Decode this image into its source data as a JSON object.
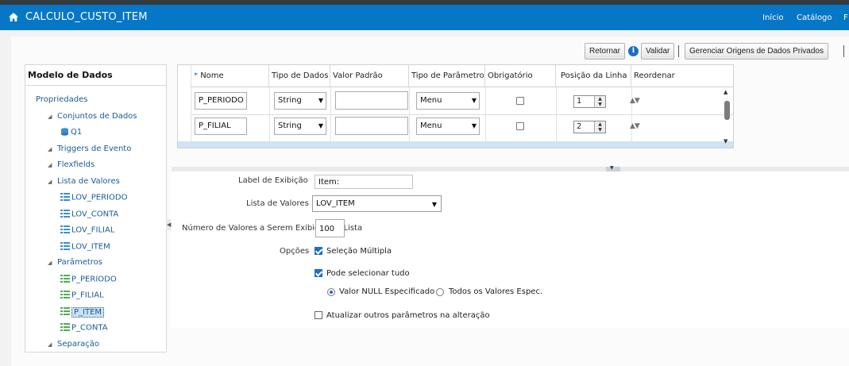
{
  "header": {
    "title": "CALCULO_CUSTO_ITEM",
    "links": [
      "Início",
      "Catálogo",
      "F"
    ]
  },
  "toolbar": {
    "return_label": "Retornar",
    "info_icon": "i",
    "validate_label": "Validar",
    "manage_label": "Gerenciar Origens de Dados Privados"
  },
  "left_panel": {
    "title": "Modelo de Dados",
    "tree": {
      "properties": "Propriedades",
      "datasets": "Conjuntos de Dados",
      "q1": "Q1",
      "triggers": "Triggers de Evento",
      "flexfields": "Flexfields",
      "lov_list": "Lista de Valores",
      "lov_periodo": "LOV_PERIODO",
      "lov_conta": "LOV_CONTA",
      "lov_filial": "LOV_FILIAL",
      "lov_item": "LOV_ITEM",
      "parameters": "Parâmetros",
      "p_periodo": "P_PERIODO",
      "p_filial": "P_FILIAL",
      "p_item": "P_ITEM",
      "p_conta": "P_CONTA",
      "separation": "Separação"
    }
  },
  "grid": {
    "required_marker": "*",
    "headers": [
      "Nome",
      "Tipo de Dados",
      "Valor Padrão",
      "Tipo de Parâmetro",
      "Obrigatório",
      "Posição da Linha",
      "Reordenar"
    ],
    "rows": [
      {
        "name": "P_PERIODO",
        "data_type": "String",
        "default": "",
        "param_type": "Menu",
        "required": false,
        "position": "1"
      },
      {
        "name": "P_FILIAL",
        "data_type": "String",
        "default": "",
        "param_type": "Menu",
        "required": false,
        "position": "2"
      }
    ]
  },
  "detail": {
    "display_label_label": "Label de Exibição",
    "display_label_value": "Item:",
    "lov_label": "Lista de Valores",
    "lov_value": "LOV_ITEM",
    "num_values_label": "Número de Valores a Serem Exibidos na Lista",
    "num_values_value": "100",
    "options_label": "Opções",
    "multi_select": "Seleção Múltipla",
    "select_all": "Pode selecionar tudo",
    "radio_null": "Valor NULL Especificado",
    "radio_all": "Todos os Valores Espec.",
    "refresh_others": "Atualizar outros parâmetros na alteração"
  }
}
